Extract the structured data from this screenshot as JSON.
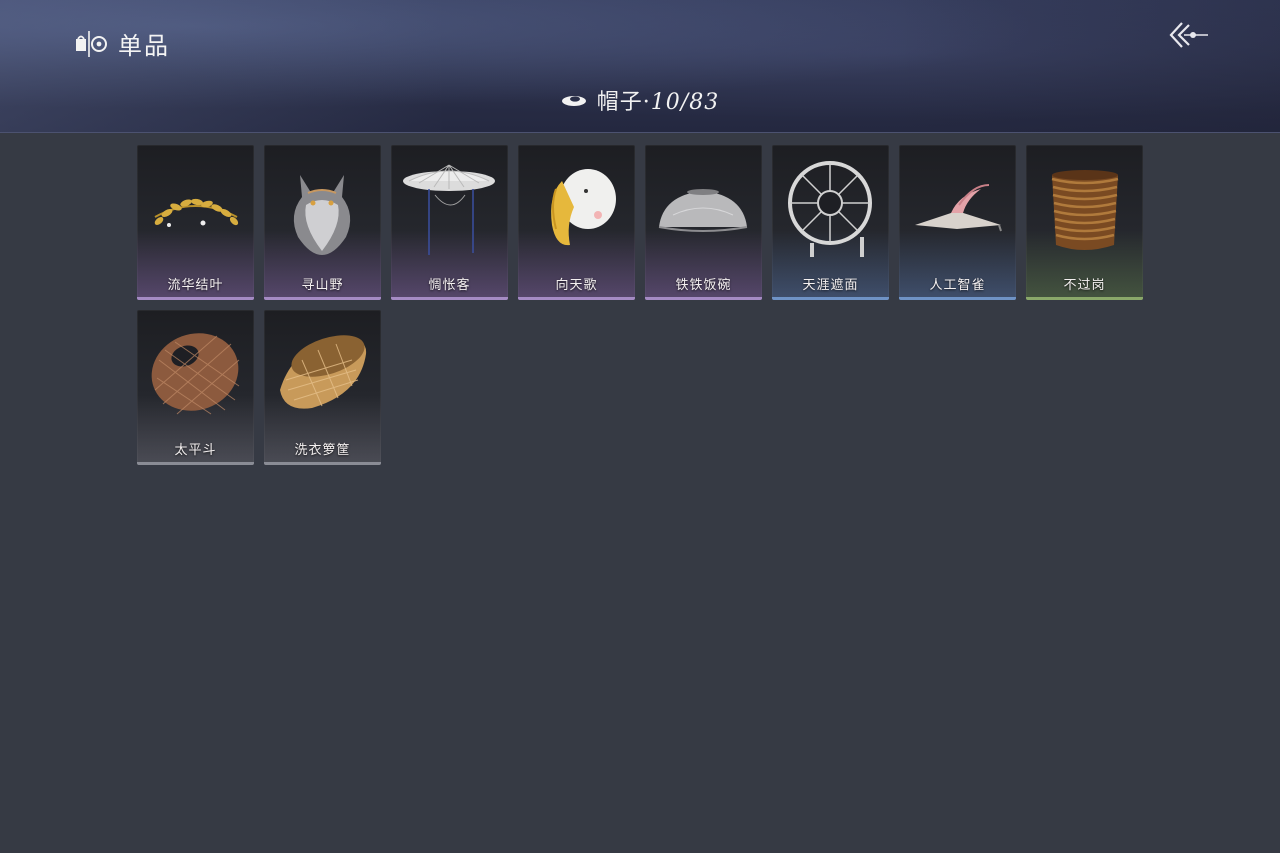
{
  "header": {
    "title": "单品",
    "icon": "wardrobe-icon",
    "back_icon": "back-arrow-icon"
  },
  "category": {
    "icon": "hat-icon",
    "label": "帽子·",
    "count": "10/83"
  },
  "items": [
    {
      "name": "流华结叶",
      "rarity": "purple",
      "icon": "golden-leaf-crown"
    },
    {
      "name": "寻山野",
      "rarity": "purple",
      "icon": "wolf-head-hat"
    },
    {
      "name": "惆怅客",
      "rarity": "purple",
      "icon": "veiled-straw-hat"
    },
    {
      "name": "向天歌",
      "rarity": "purple",
      "icon": "goose-hood"
    },
    {
      "name": "铁铁饭碗",
      "rarity": "purple",
      "icon": "iron-bowl-hat"
    },
    {
      "name": "天涯遮面",
      "rarity": "blue",
      "icon": "spoked-parasol-hat"
    },
    {
      "name": "人工智雀",
      "rarity": "blue",
      "icon": "bird-flat-hat"
    },
    {
      "name": "不过岗",
      "rarity": "green",
      "icon": "stacked-bowls-hat"
    },
    {
      "name": "太平斗",
      "rarity": "gray",
      "icon": "woven-basket-hat"
    },
    {
      "name": "洗衣箩筐",
      "rarity": "gray",
      "icon": "laundry-basket-hat"
    }
  ],
  "colors": {
    "background": "#363a44",
    "purple": "#a58bc4",
    "blue": "#6f93c6",
    "green": "#8aa86a",
    "gray": "#8a8c95"
  }
}
